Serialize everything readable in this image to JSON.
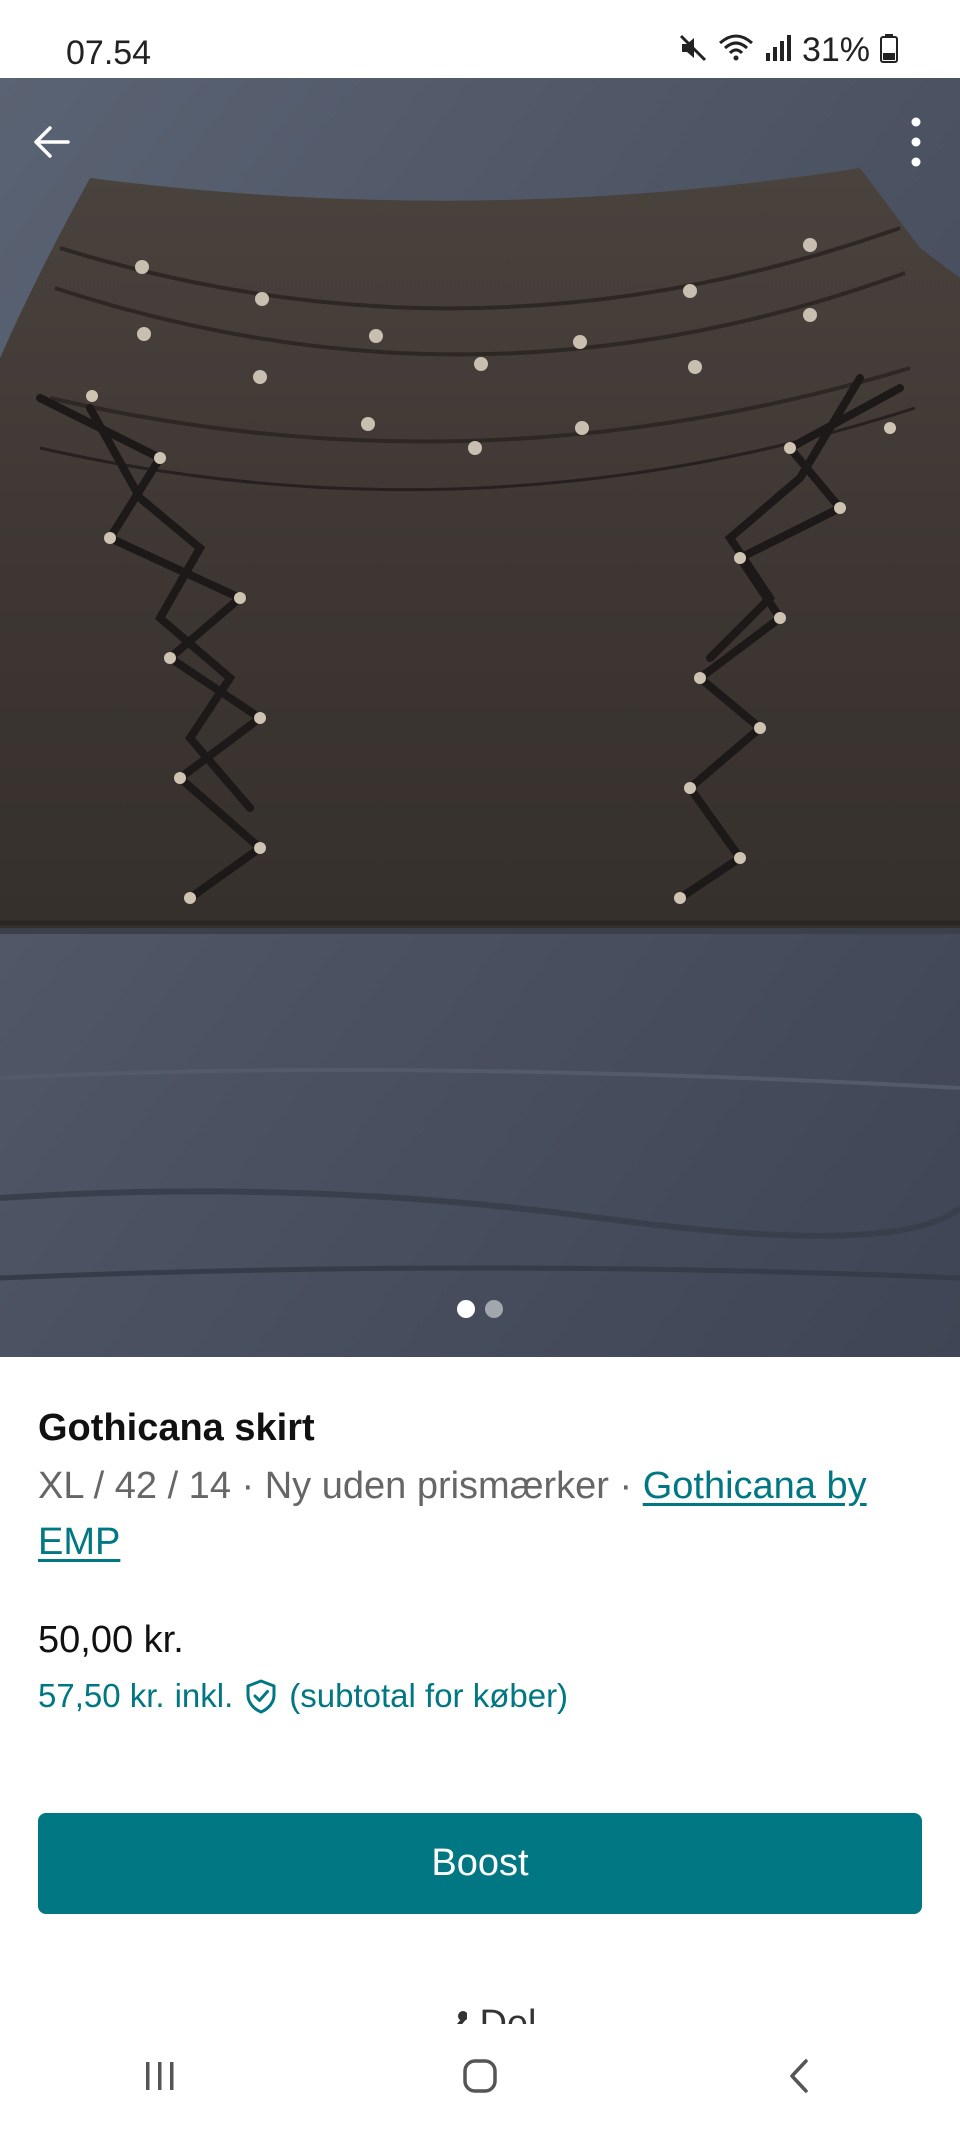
{
  "status_bar": {
    "time": "07.54",
    "battery": "31%",
    "icons": [
      "mute-icon",
      "wifi-icon",
      "signal-icon",
      "battery-icon"
    ]
  },
  "photo": {
    "icons": [
      "back-arrow-icon",
      "more-vertical-icon"
    ],
    "pager": {
      "current": 1,
      "total": 2
    }
  },
  "listing": {
    "title": "Gothicana skirt",
    "meta_text": "XL / 42 / 14 · Ny uden prismærker · ",
    "brand": "Gothicana by EMP",
    "price": "50,00 kr.",
    "total_price": "57,50 kr.",
    "total_incl": "inkl.",
    "total_note": "(subtotal for køber)"
  },
  "actions": {
    "boost_label": "Boost",
    "share_label": "Del"
  },
  "colors": {
    "accent": "#007782"
  },
  "nav_bar": {
    "icons": [
      "recent-apps-icon",
      "home-icon",
      "back-icon"
    ]
  }
}
